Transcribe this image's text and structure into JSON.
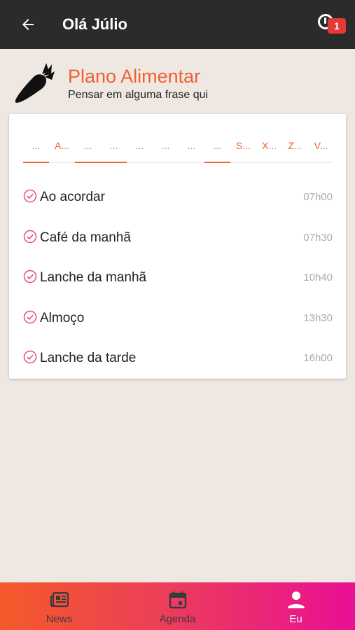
{
  "topbar": {
    "title": "Olá Júlio",
    "notification_count": "1"
  },
  "header": {
    "title": "Plano Alimentar",
    "subtitle": "Pensar em alguma frase qui"
  },
  "tabs": [
    {
      "label": "...",
      "active": true
    },
    {
      "label": "A...",
      "active": false
    },
    {
      "label": "...",
      "active": true
    },
    {
      "label": "...",
      "active": true
    },
    {
      "label": "...",
      "active": false
    },
    {
      "label": "...",
      "active": false
    },
    {
      "label": "...",
      "active": false
    },
    {
      "label": "...",
      "active": true
    },
    {
      "label": "S...",
      "active": false
    },
    {
      "label": "X...",
      "active": false
    },
    {
      "label": "Z...",
      "active": false
    },
    {
      "label": "V...",
      "active": false
    }
  ],
  "meals": [
    {
      "name": "Ao acordar",
      "time": "07h00"
    },
    {
      "name": "Café da manhã",
      "time": "07h30"
    },
    {
      "name": "Lanche da manhã",
      "time": "10h40"
    },
    {
      "name": "Almoço",
      "time": "13h30"
    },
    {
      "name": "Lanche da tarde",
      "time": "16h00"
    }
  ],
  "bottom_nav": [
    {
      "label": "News",
      "icon": "newspaper-icon",
      "active": false
    },
    {
      "label": "Agenda",
      "icon": "calendar-icon",
      "active": false
    },
    {
      "label": "Eu",
      "icon": "person-icon",
      "active": true
    }
  ],
  "colors": {
    "accent": "#ee6131",
    "topbar": "#2b2b2b",
    "background": "#efe8e2",
    "check": "#ec4a7a",
    "badge": "#e53935"
  }
}
